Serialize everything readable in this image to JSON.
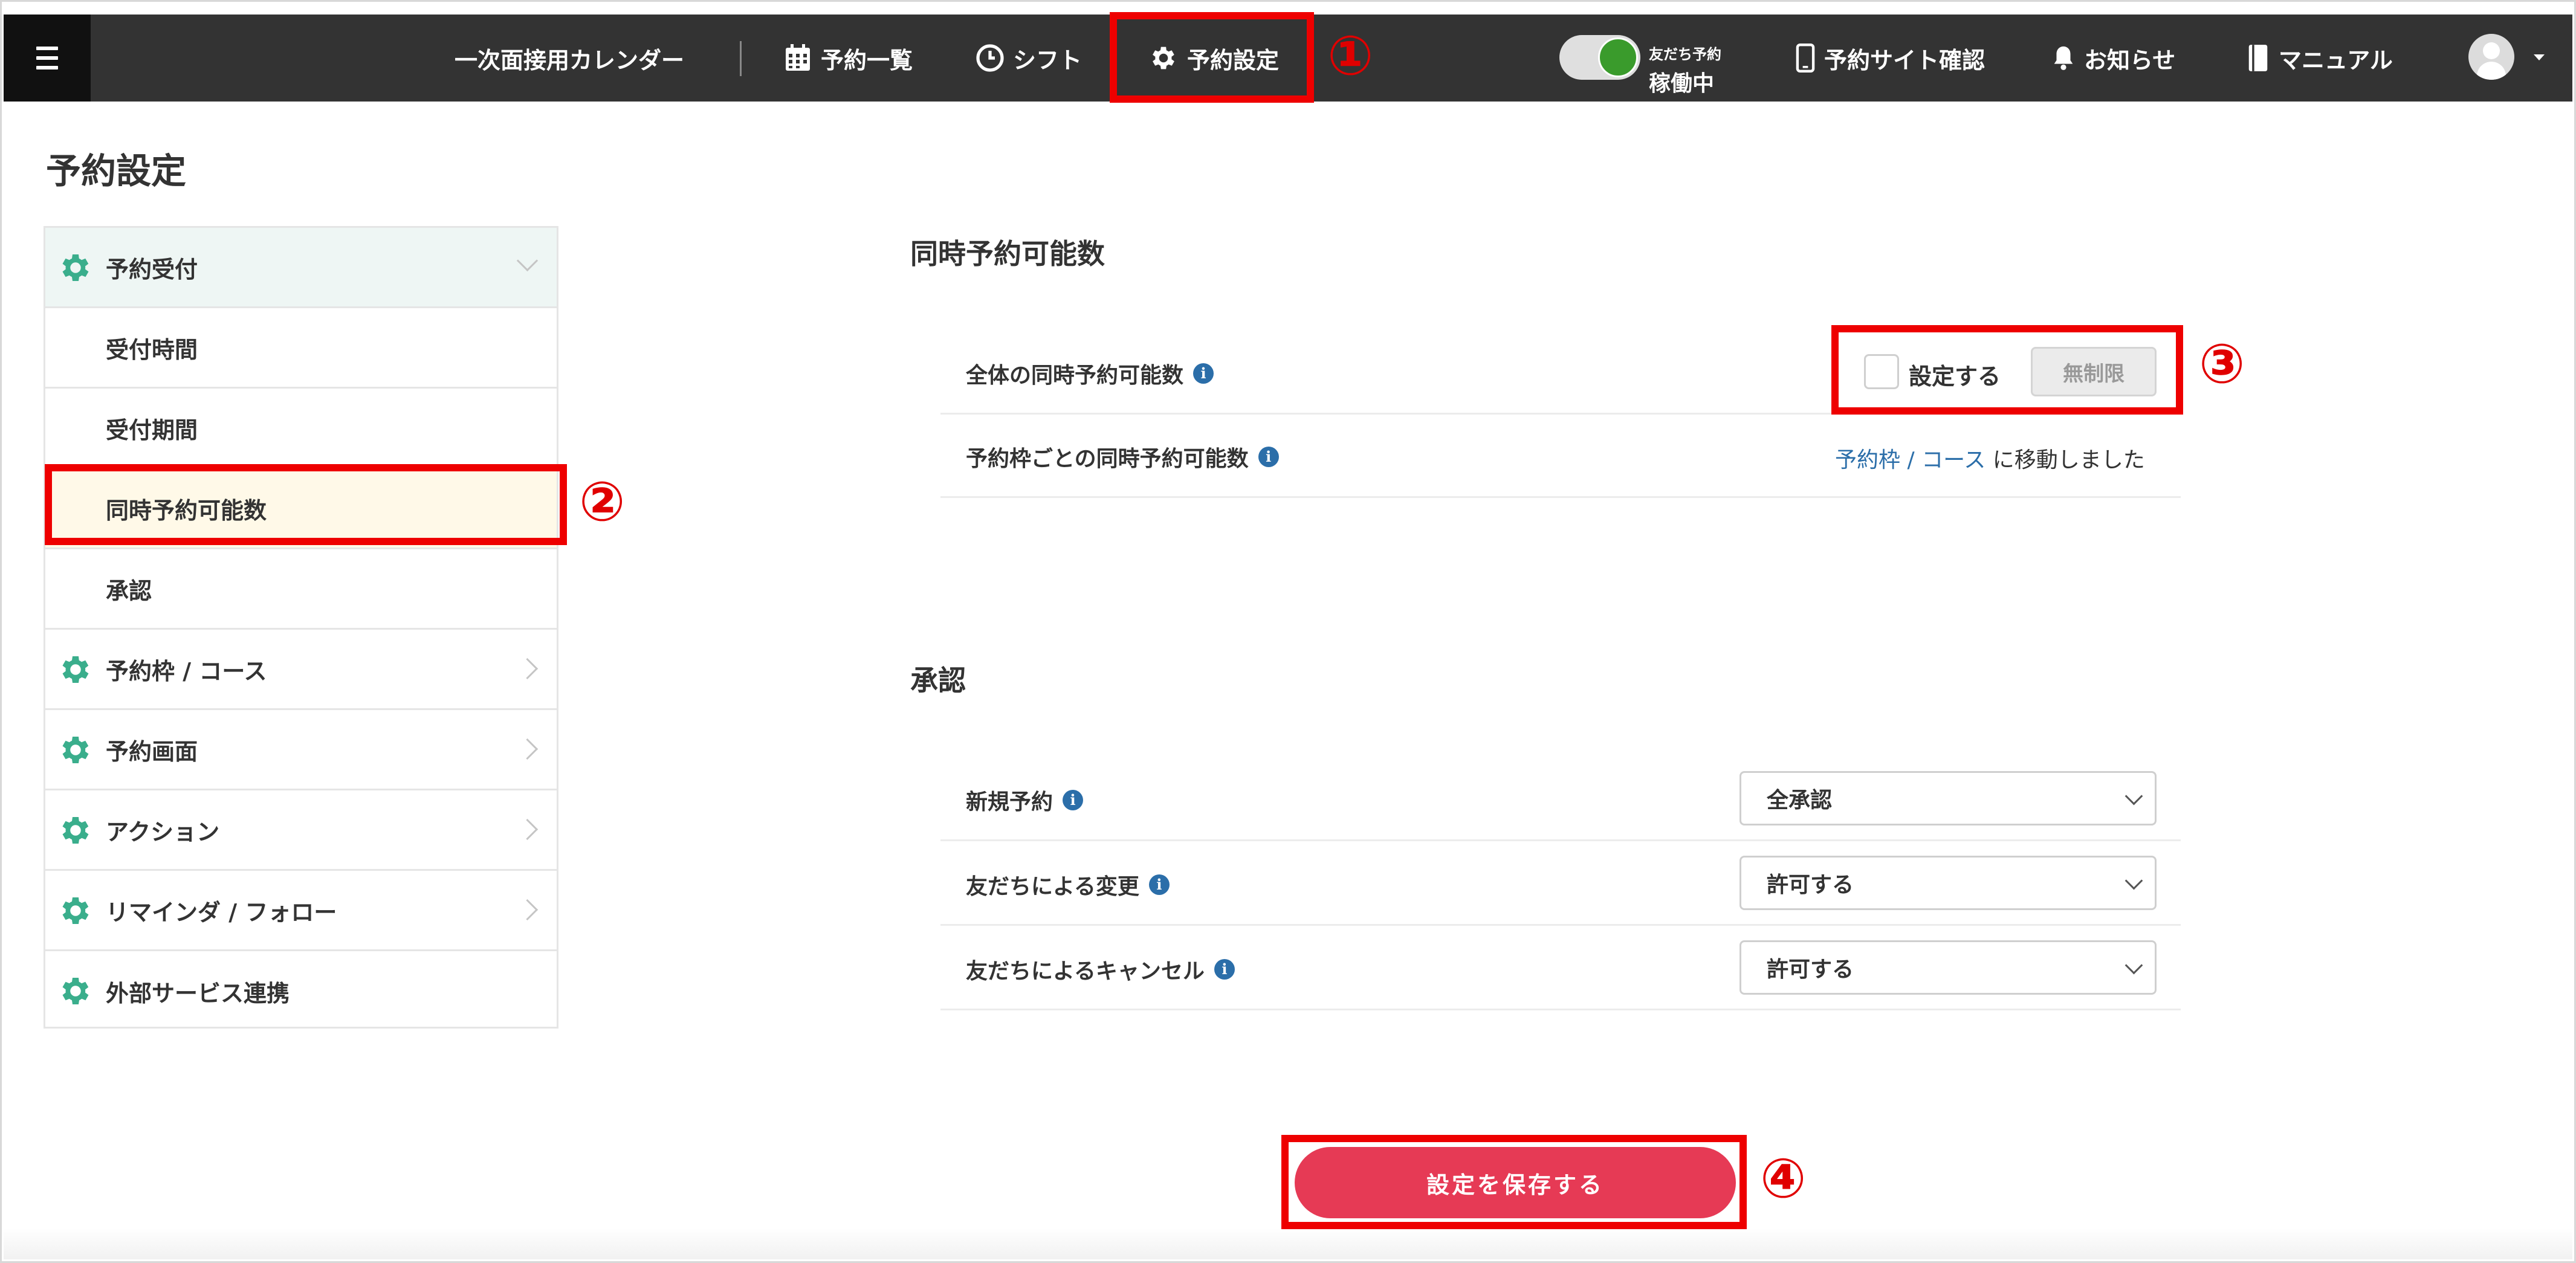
{
  "colors": {
    "topbar": "#333333",
    "accent_red": "#e63a55",
    "annotation": "#ee0000",
    "link": "#2b6ea9",
    "gear": "#3aae8c",
    "toggle_on": "#3a9b2c"
  },
  "topbar": {
    "menu_icon": "hamburger-icon",
    "app_title": "一次面接用カレンダー",
    "nav": [
      {
        "icon": "calendar-icon",
        "label": "予約一覧"
      },
      {
        "icon": "clock-icon",
        "label": "シフト"
      },
      {
        "icon": "gear-icon",
        "label": "予約設定"
      }
    ],
    "toggle": {
      "caption": "友だち予約",
      "status": "稼働中",
      "on": true
    },
    "right_links": [
      {
        "icon": "smartphone-icon",
        "label": "予約サイト確認"
      },
      {
        "icon": "bell-icon",
        "label": "お知らせ"
      },
      {
        "icon": "book-icon",
        "label": "マニュアル"
      }
    ],
    "avatar_icon": "user-avatar-icon"
  },
  "page": {
    "title": "予約設定"
  },
  "sidebar": {
    "items": [
      {
        "label": "予約受付",
        "icon": "gear-icon",
        "expanded": true
      },
      {
        "label": "受付時間"
      },
      {
        "label": "受付期間"
      },
      {
        "label": "同時予約可能数",
        "active": true
      },
      {
        "label": "承認"
      },
      {
        "label": "予約枠 / コース",
        "icon": "gear-icon"
      },
      {
        "label": "予約画面",
        "icon": "gear-icon"
      },
      {
        "label": "アクション",
        "icon": "gear-icon"
      },
      {
        "label": "リマインダ / フォロー",
        "icon": "gear-icon"
      },
      {
        "label": "外部サービス連携",
        "icon": "gear-icon"
      }
    ]
  },
  "concurrent": {
    "title": "同時予約可能数",
    "total_label": "全体の同時予約可能数",
    "checkbox_label": "設定する",
    "checkbox_checked": false,
    "input_placeholder": "無制限",
    "per_slot_label": "予約枠ごとの同時予約可能数",
    "link1": "予約枠",
    "link_sep": "/",
    "link2": "コース",
    "moved_text": "に移動しました"
  },
  "approval": {
    "title": "承認",
    "rows": [
      {
        "label": "新規予約",
        "value": "全承認"
      },
      {
        "label": "友だちによる変更",
        "value": "許可する"
      },
      {
        "label": "友だちによるキャンセル",
        "value": "許可する"
      }
    ]
  },
  "save_button": "設定を保存する",
  "annotations": [
    "①",
    "②",
    "③",
    "④"
  ]
}
